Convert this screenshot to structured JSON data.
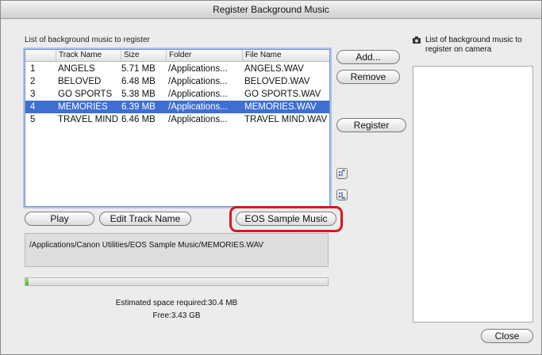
{
  "window": {
    "title": "Register Background Music"
  },
  "left_list_label": "List of background music to register",
  "right_list_label": "List of background music to register on camera",
  "table": {
    "columns": [
      "Track Name",
      "Size",
      "Folder",
      "File Name"
    ],
    "rows": [
      {
        "num": "1",
        "track": "ANGELS",
        "size": "5.71 MB",
        "folder": "/Applications...",
        "file": "ANGELS.WAV",
        "selected": false
      },
      {
        "num": "2",
        "track": "BELOVED",
        "size": "6.48 MB",
        "folder": "/Applications...",
        "file": "BELOVED.WAV",
        "selected": false
      },
      {
        "num": "3",
        "track": "GO SPORTS",
        "size": "5.38 MB",
        "folder": "/Applications...",
        "file": "GO SPORTS.WAV",
        "selected": false
      },
      {
        "num": "4",
        "track": "MEMORIES",
        "size": "6.39 MB",
        "folder": "/Applications...",
        "file": "MEMORIES.WAV",
        "selected": true
      },
      {
        "num": "5",
        "track": "TRAVEL MIND",
        "size": "6.46 MB",
        "folder": "/Applications...",
        "file": "TRAVEL MIND.WAV",
        "selected": false
      }
    ]
  },
  "buttons": {
    "add": "Add...",
    "remove": "Remove",
    "register": "Register",
    "play": "Play",
    "edit_track_name": "Edit Track Name",
    "eos_sample_music": "EOS Sample Music",
    "close": "Close"
  },
  "icons": {
    "move_up": "move-up-icon",
    "move_down": "move-down-icon",
    "camera": "camera-icon"
  },
  "selected_path": "/Applications/Canon Utilities/EOS Sample Music/MEMORIES.WAV",
  "progress": {
    "fraction": 0.01
  },
  "estimated_space": "Estimated space required:30.4 MB",
  "free_space": "Free:3.43 GB",
  "colors": {
    "selection": "#3f6fd0",
    "highlight_border": "#e0141e"
  }
}
